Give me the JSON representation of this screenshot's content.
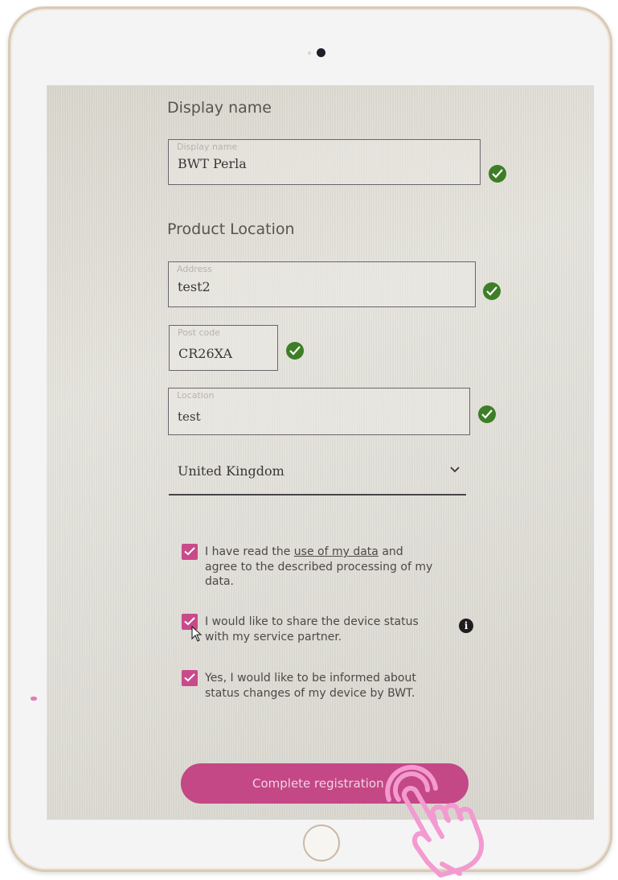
{
  "display_name_section": {
    "title": "Display name",
    "field_label": "Display name",
    "field_value": "BWT Perla"
  },
  "product_location_section": {
    "title": "Product Location",
    "address_label": "Address",
    "address_value": "test2",
    "postcode_label": "Post code",
    "postcode_value": "CR26XA",
    "location_label": "Location",
    "location_value": "test",
    "country_value": "United Kingdom"
  },
  "consents": [
    {
      "text_before": "I have read the ",
      "link": "use of my data",
      "text_after": " and agree to the described processing of my data.",
      "checked": true
    },
    {
      "text": "I would like to share the device status with my service partner.",
      "checked": true
    },
    {
      "text": "Yes, I would like to be informed about status changes of my device by BWT.",
      "checked": true
    }
  ],
  "info_icon": "i",
  "submit_button_label": "Complete registration",
  "colors": {
    "accent": "#c44786",
    "check_green": "#3d7e26",
    "checkbox_pink": "#c94a8a",
    "hand_pink": "#f39ad0"
  },
  "icons": [
    "check-icon",
    "chevron-down-icon",
    "checkbox-checked-icon",
    "info-icon",
    "cursor-icon",
    "hand-tap-icon",
    "camera-icon",
    "home-button"
  ]
}
